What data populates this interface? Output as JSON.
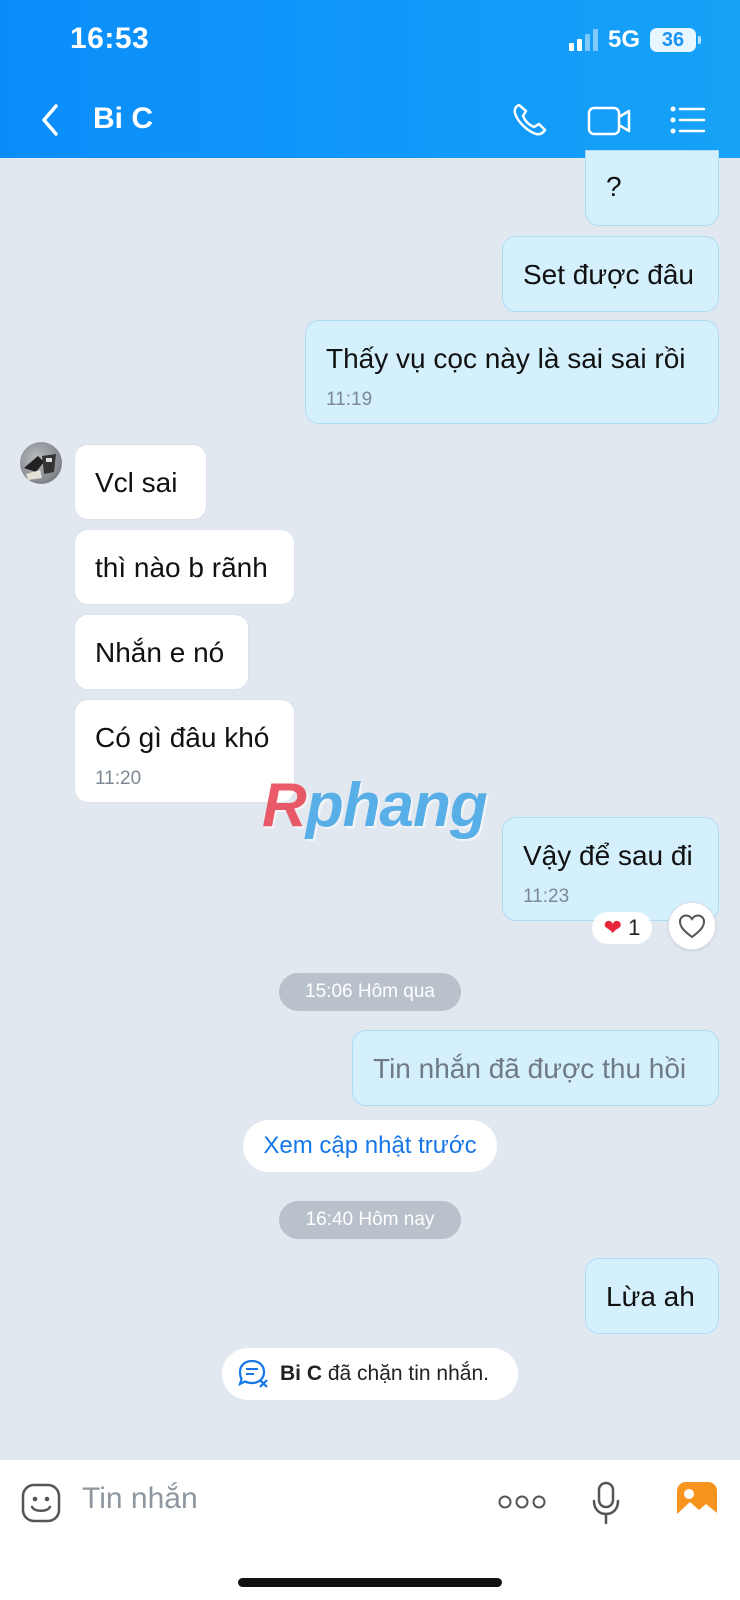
{
  "status_bar": {
    "time": "16:53",
    "network": "5G",
    "battery": "36"
  },
  "header": {
    "title": "Bi C"
  },
  "messages": [
    {
      "side": "me",
      "text": "?"
    },
    {
      "side": "me",
      "text": "Set được đâu"
    },
    {
      "side": "me",
      "text": "Thấy vụ cọc này là sai sai rồi",
      "time": "11:19"
    },
    {
      "side": "other",
      "text": "Vcl sai"
    },
    {
      "side": "other",
      "text": "thì nào b rãnh"
    },
    {
      "side": "other",
      "text": "Nhắn e nó"
    },
    {
      "side": "other",
      "text": "Có gì đâu khó",
      "time": "11:20"
    },
    {
      "side": "me",
      "text": "Vậy để sau đi",
      "time": "11:23"
    },
    {
      "side": "me",
      "text": "Tin nhắn đã được thu hồi"
    },
    {
      "side": "me",
      "text": "Lừa ah"
    }
  ],
  "reaction": {
    "emoji": "❤",
    "count": "1"
  },
  "separators": {
    "yesterday": "15:06 Hôm qua",
    "today": "16:40 Hôm nay"
  },
  "view_previous_updates": "Xem cập nhật trước",
  "blocked_notice": {
    "name": "Bi C",
    "text": "đã chặn tin nhắn."
  },
  "watermark": {
    "first": "R",
    "rest": "phang"
  },
  "composer": {
    "placeholder": "Tin nhắn"
  },
  "colors": {
    "header": "#0a8dfb",
    "my_bubble": "#d4f0fd",
    "other_bubble": "#ffffff",
    "background": "#e2e8f0",
    "link": "#1677e8"
  },
  "icons": [
    "back-icon",
    "phone-icon",
    "video-call-icon",
    "menu-list-icon",
    "sticker-icon",
    "more-icon",
    "microphone-icon",
    "image-icon",
    "heart-icon",
    "blocked-chat-icon"
  ]
}
